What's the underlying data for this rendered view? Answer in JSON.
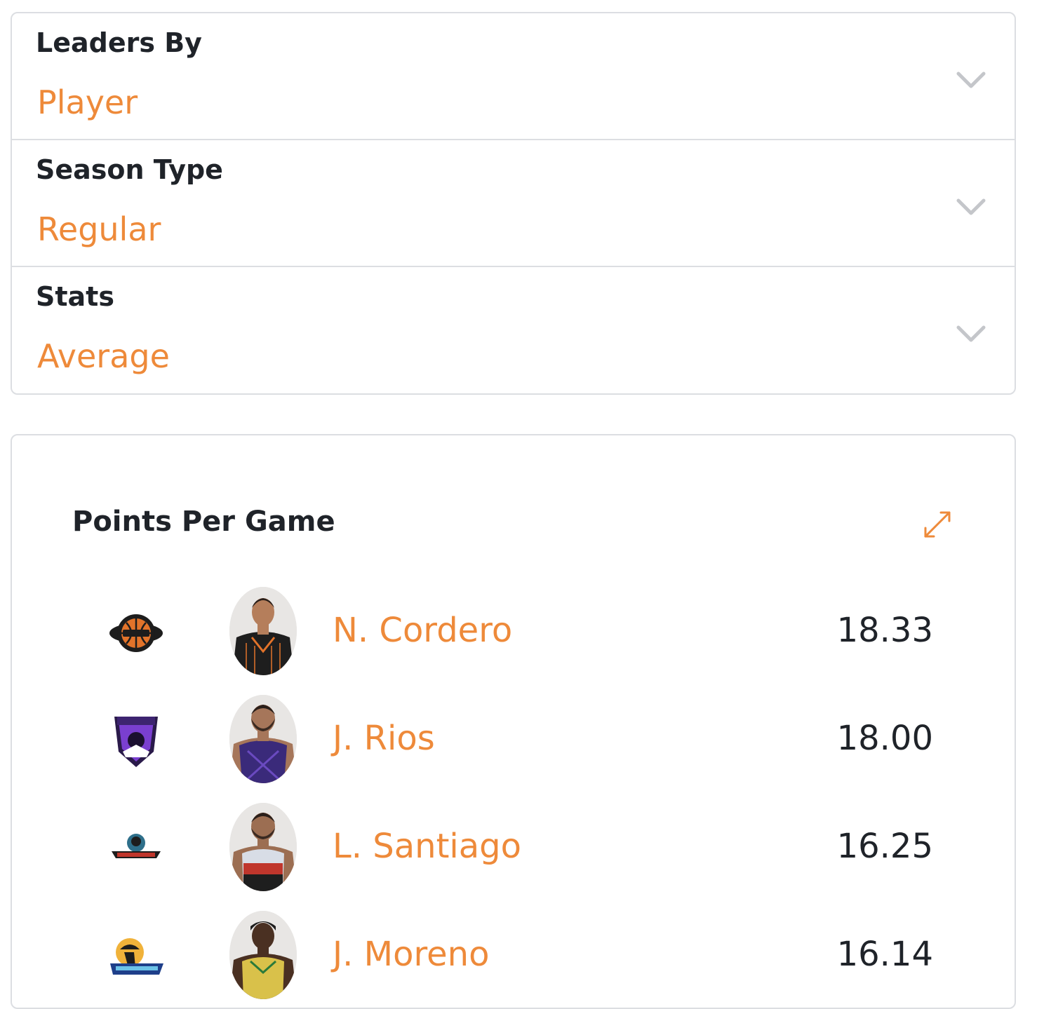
{
  "filters": [
    {
      "label": "Leaders By",
      "value": "Player"
    },
    {
      "label": "Season Type",
      "value": "Regular"
    },
    {
      "label": "Stats",
      "value": "Average"
    }
  ],
  "colors": {
    "accent": "#ee8a3a",
    "text": "#1f2329",
    "border": "#dcdee2",
    "chevron": "#c4c6ca"
  },
  "leaders_card": {
    "title": "Points Per Game",
    "expand_icon": "expand-arrows-icon",
    "rows": [
      {
        "team_logo": "team-challenge-logo",
        "player_name": "N. Cordero",
        "value": "18.33"
      },
      {
        "team_logo": "knights-logo",
        "player_name": "J. Rios",
        "value": "18.00"
      },
      {
        "team_logo": "patriotas-logo",
        "player_name": "L. Santiago",
        "value": "16.25"
      },
      {
        "team_logo": "llaneros-logo",
        "player_name": "J. Moreno",
        "value": "16.14"
      }
    ]
  }
}
